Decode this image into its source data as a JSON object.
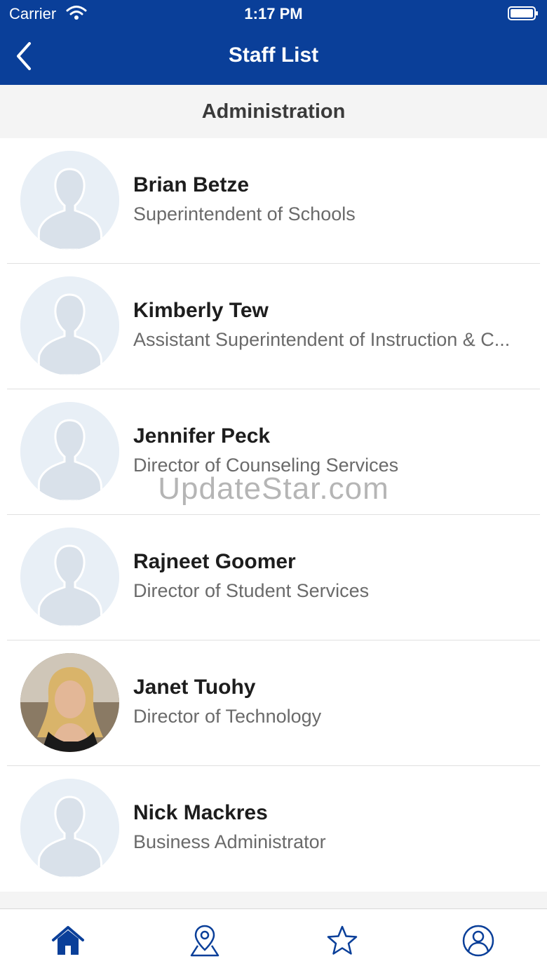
{
  "status_bar": {
    "carrier": "Carrier",
    "time": "1:17 PM"
  },
  "nav": {
    "title": "Staff List"
  },
  "section": {
    "title": "Administration"
  },
  "staff": [
    {
      "name": "Brian Betze",
      "title": "Superintendent of Schools",
      "photo": "placeholder"
    },
    {
      "name": "Kimberly Tew",
      "title": "Assistant Superintendent of Instruction & C...",
      "photo": "placeholder"
    },
    {
      "name": "Jennifer Peck",
      "title": "Director of Counseling Services",
      "photo": "placeholder"
    },
    {
      "name": "Rajneet Goomer",
      "title": "Director of Student Services",
      "photo": "placeholder"
    },
    {
      "name": "Janet Tuohy",
      "title": "Director of Technology",
      "photo": "portrait"
    },
    {
      "name": "Nick Mackres",
      "title": "Business Administrator",
      "photo": "placeholder"
    }
  ],
  "watermark": "UpdateStar.com",
  "tabs": [
    {
      "icon": "home-icon",
      "active": true
    },
    {
      "icon": "map-pin-icon",
      "active": false
    },
    {
      "icon": "star-icon",
      "active": false
    },
    {
      "icon": "user-circle-icon",
      "active": false
    }
  ],
  "colors": {
    "nav_blue": "#0a3f99",
    "tab_blue": "#0a3f99",
    "placeholder_bg": "#e8eff6"
  }
}
